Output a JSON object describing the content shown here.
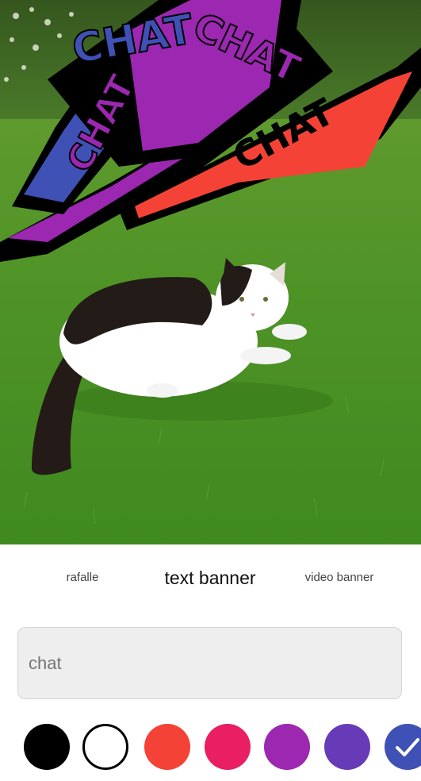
{
  "preview": {
    "banner_text": "CHAT"
  },
  "tabs": [
    {
      "label": "rafalle",
      "active": false
    },
    {
      "label": "text banner",
      "active": true
    },
    {
      "label": "video banner",
      "active": false
    }
  ],
  "text_input": {
    "value": "",
    "placeholder": "chat"
  },
  "swatches": [
    {
      "color": "#000000",
      "name": "black",
      "selected": false
    },
    {
      "color": "#ffffff",
      "name": "white",
      "selected": false
    },
    {
      "color": "#f44336",
      "name": "red",
      "selected": false
    },
    {
      "color": "#e91e63",
      "name": "pink",
      "selected": false
    },
    {
      "color": "#9c27b0",
      "name": "purple",
      "selected": false
    },
    {
      "color": "#673ab7",
      "name": "deep-purple",
      "selected": false
    },
    {
      "color": "#3f51b5",
      "name": "indigo",
      "selected": true,
      "icon": "checkmark-icon"
    }
  ]
}
